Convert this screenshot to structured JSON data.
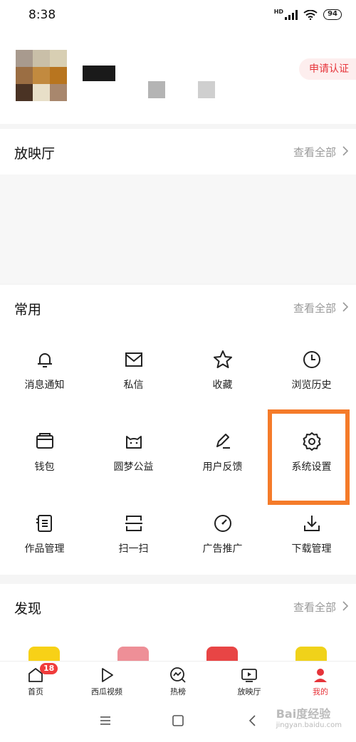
{
  "status_bar": {
    "time": "8:38",
    "battery": "94",
    "network": "HD"
  },
  "profile": {
    "verify_label": "申请认证"
  },
  "theater": {
    "title": "放映厅",
    "more": "查看全部"
  },
  "common": {
    "title": "常用",
    "more": "查看全部",
    "items": [
      {
        "label": "消息通知",
        "icon": "bell-icon"
      },
      {
        "label": "私信",
        "icon": "envelope-icon"
      },
      {
        "label": "收藏",
        "icon": "star-icon"
      },
      {
        "label": "浏览历史",
        "icon": "clock-icon"
      },
      {
        "label": "钱包",
        "icon": "wallet-icon"
      },
      {
        "label": "圆梦公益",
        "icon": "charity-cat-icon"
      },
      {
        "label": "用户反馈",
        "icon": "edit-pen-icon"
      },
      {
        "label": "系统设置",
        "icon": "gear-icon"
      },
      {
        "label": "作品管理",
        "icon": "document-list-icon"
      },
      {
        "label": "扫一扫",
        "icon": "scan-icon"
      },
      {
        "label": "广告推广",
        "icon": "gauge-icon"
      },
      {
        "label": "下载管理",
        "icon": "download-icon"
      }
    ]
  },
  "discover": {
    "title": "发现",
    "more": "查看全部"
  },
  "tabbar": {
    "items": [
      {
        "label": "首页",
        "icon": "home-icon",
        "badge": "18"
      },
      {
        "label": "西瓜视频",
        "icon": "play-icon"
      },
      {
        "label": "热榜",
        "icon": "trending-icon"
      },
      {
        "label": "放映厅",
        "icon": "tv-icon"
      },
      {
        "label": "我的",
        "icon": "user-icon"
      }
    ]
  },
  "watermark": {
    "brand": "Bai度经验",
    "url": "jingyan.baidu.com"
  },
  "colors": {
    "accent": "#e6343a",
    "highlight": "#f57b2a"
  }
}
